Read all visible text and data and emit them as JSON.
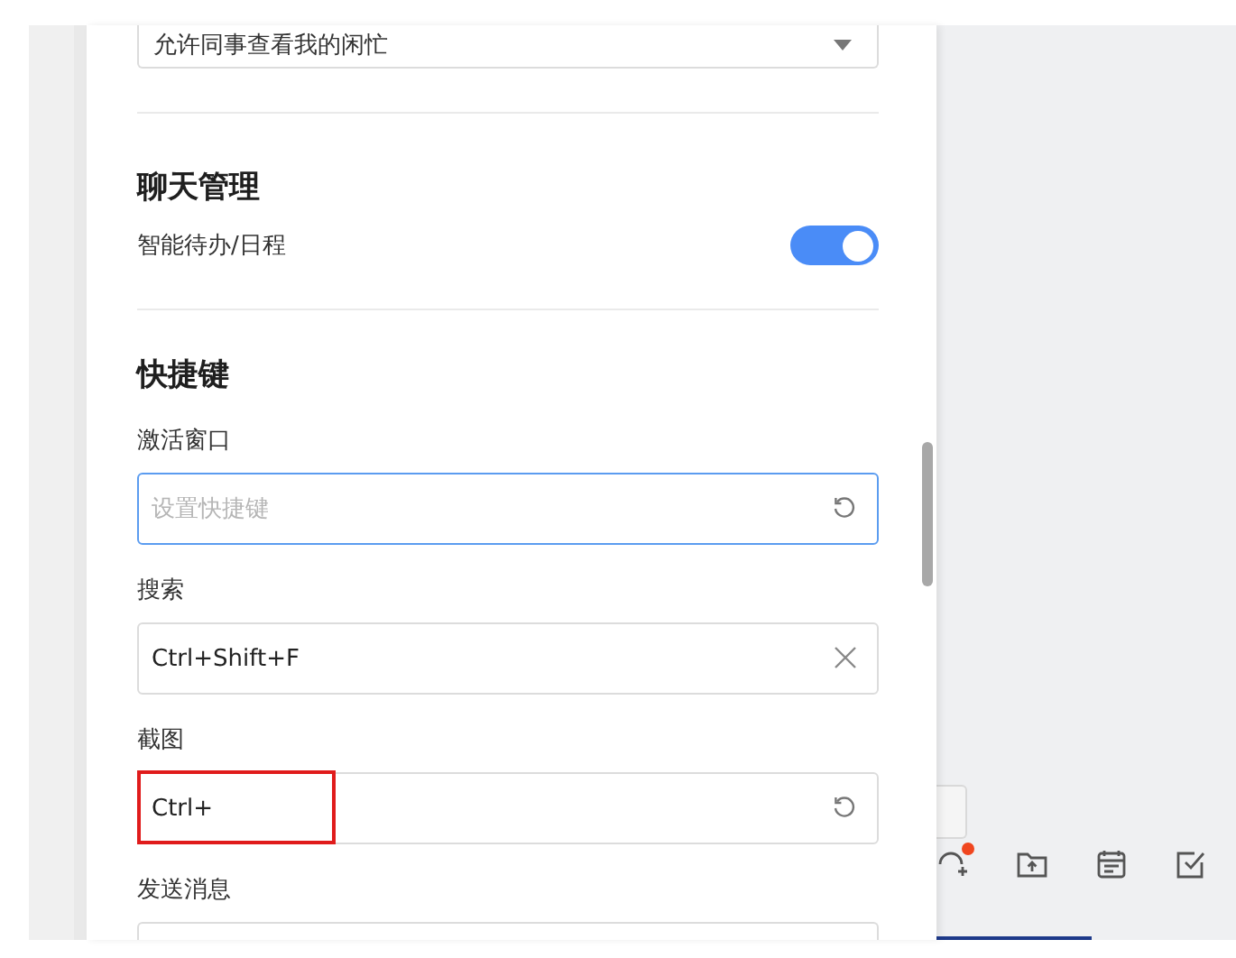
{
  "availability_select": {
    "value": "允许同事查看我的闲忙"
  },
  "sections": [
    {
      "title": "聊天管理",
      "kind": "toggles",
      "items": [
        {
          "label": "智能待办/日程",
          "on": true
        }
      ]
    },
    {
      "title": "快捷键",
      "kind": "shortcuts",
      "items": [
        {
          "label": "激活窗口",
          "placeholder": "设置快捷键",
          "kind": "reset",
          "focused": true,
          "highlighted": false
        },
        {
          "label": "搜索",
          "value": "Ctrl+Shift+F",
          "kind": "clear",
          "focused": false,
          "highlighted": false
        },
        {
          "label": "截图",
          "value": "Ctrl+",
          "kind": "reset",
          "focused": false,
          "highlighted": true
        },
        {
          "label": "发送消息",
          "kind": "partial"
        }
      ]
    }
  ],
  "toolbar": [
    {
      "kind": "add-person",
      "badge": true
    },
    {
      "kind": "folder-upload",
      "badge": false
    },
    {
      "kind": "calendar",
      "badge": false
    },
    {
      "kind": "task",
      "badge": false
    }
  ]
}
